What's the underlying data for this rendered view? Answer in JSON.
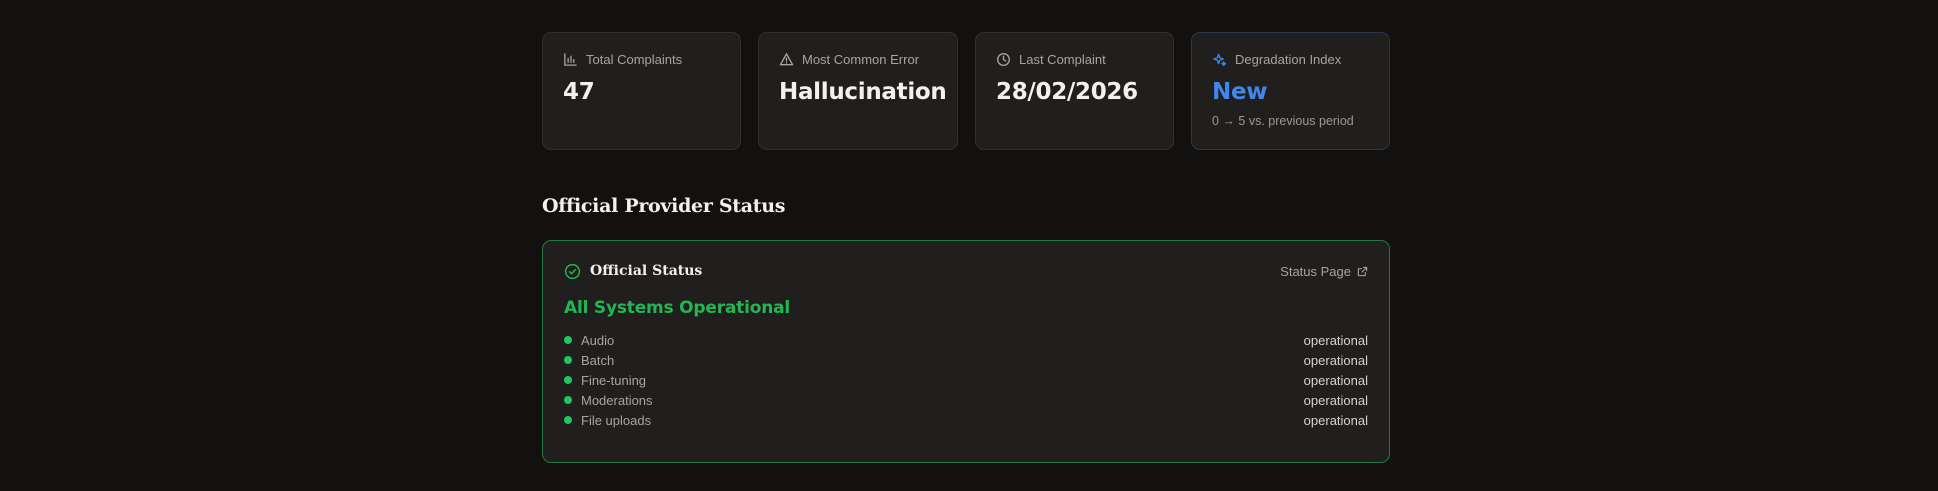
{
  "colors": {
    "background": "#121110",
    "card": "#211f1d",
    "accent_blue": "#3f86ee",
    "status_green": "#23b655",
    "status_border": "#237a3c"
  },
  "stats": [
    {
      "label": "Total Complaints",
      "value": "47",
      "icon": "bar-chart-icon"
    },
    {
      "label": "Most Common Error",
      "value": "Hallucination",
      "icon": "warning-triangle-icon"
    },
    {
      "label": "Last Complaint",
      "value": "28/02/2026",
      "icon": "clock-icon"
    },
    {
      "label": "Degradation Index",
      "value": "New",
      "icon": "sparkles-icon",
      "sub": "0 → 5 vs. previous period"
    }
  ],
  "provider_section": {
    "title": "Official Provider Status"
  },
  "status_card": {
    "icon": "check-circle-icon",
    "name": "Official Status",
    "link_label": "Status Page",
    "link_icon": "external-link-icon",
    "headline": "All Systems Operational",
    "components": [
      {
        "name": "Audio",
        "state": "operational"
      },
      {
        "name": "Batch",
        "state": "operational"
      },
      {
        "name": "Fine-tuning",
        "state": "operational"
      },
      {
        "name": "Moderations",
        "state": "operational"
      },
      {
        "name": "File uploads",
        "state": "operational"
      }
    ]
  }
}
